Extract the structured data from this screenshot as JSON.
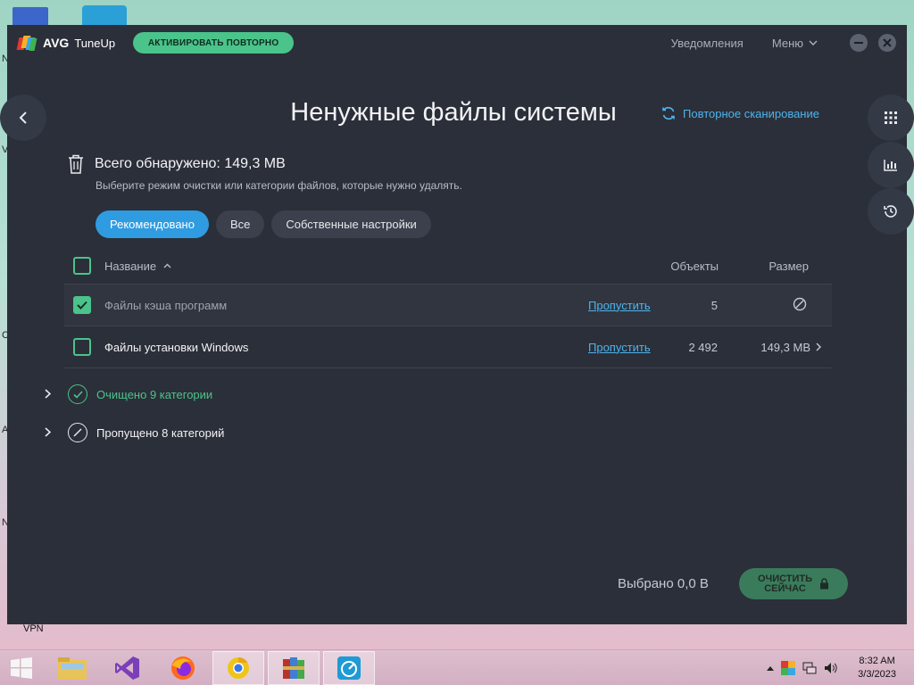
{
  "app": {
    "brand": "AVG",
    "product": "TuneUp",
    "activate_label": "АКТИВИРОВАТЬ ПОВТОРНО",
    "notifications_label": "Уведомления",
    "menu_label": "Меню"
  },
  "page": {
    "title": "Ненужные файлы системы",
    "rescan_label": "Повторное сканирование"
  },
  "summary": {
    "title": "Всего обнаружено: 149,3 MB",
    "subtitle": "Выберите режим очистки или категории файлов, которые нужно удалять."
  },
  "modes": [
    {
      "label": "Рекомендовано",
      "active": true
    },
    {
      "label": "Все",
      "active": false
    },
    {
      "label": "Собственные настройки",
      "active": false
    }
  ],
  "table": {
    "headers": {
      "name": "Название",
      "count": "Объекты",
      "size": "Размер"
    },
    "rows": [
      {
        "name": "Файлы кэша программ",
        "skip": "Пропустить",
        "count": "5",
        "size": "",
        "checked": true
      },
      {
        "name": "Файлы установки Windows",
        "skip": "Пропустить",
        "count": "2 492",
        "size": "149,3 MB",
        "checked": false
      }
    ]
  },
  "groups": {
    "cleaned": "Очищено 9 категории",
    "skipped": "Пропущено 8 категорий"
  },
  "footer": {
    "selected": "Выбрано 0,0 B",
    "clean_line1": "ОЧИСТИТЬ",
    "clean_line2": "СЕЙЧАС"
  },
  "desktop": {
    "vpn_label": "VPN",
    "edge_letters": [
      "N",
      "V",
      "C",
      "A",
      "N"
    ]
  },
  "taskbar": {
    "time": "8:32 AM",
    "date": "3/3/2023"
  },
  "colors": {
    "accent_green": "#4ac48a",
    "accent_blue": "#2f9be1",
    "link_blue": "#4fb3ec",
    "window_bg": "#2b2f39"
  }
}
